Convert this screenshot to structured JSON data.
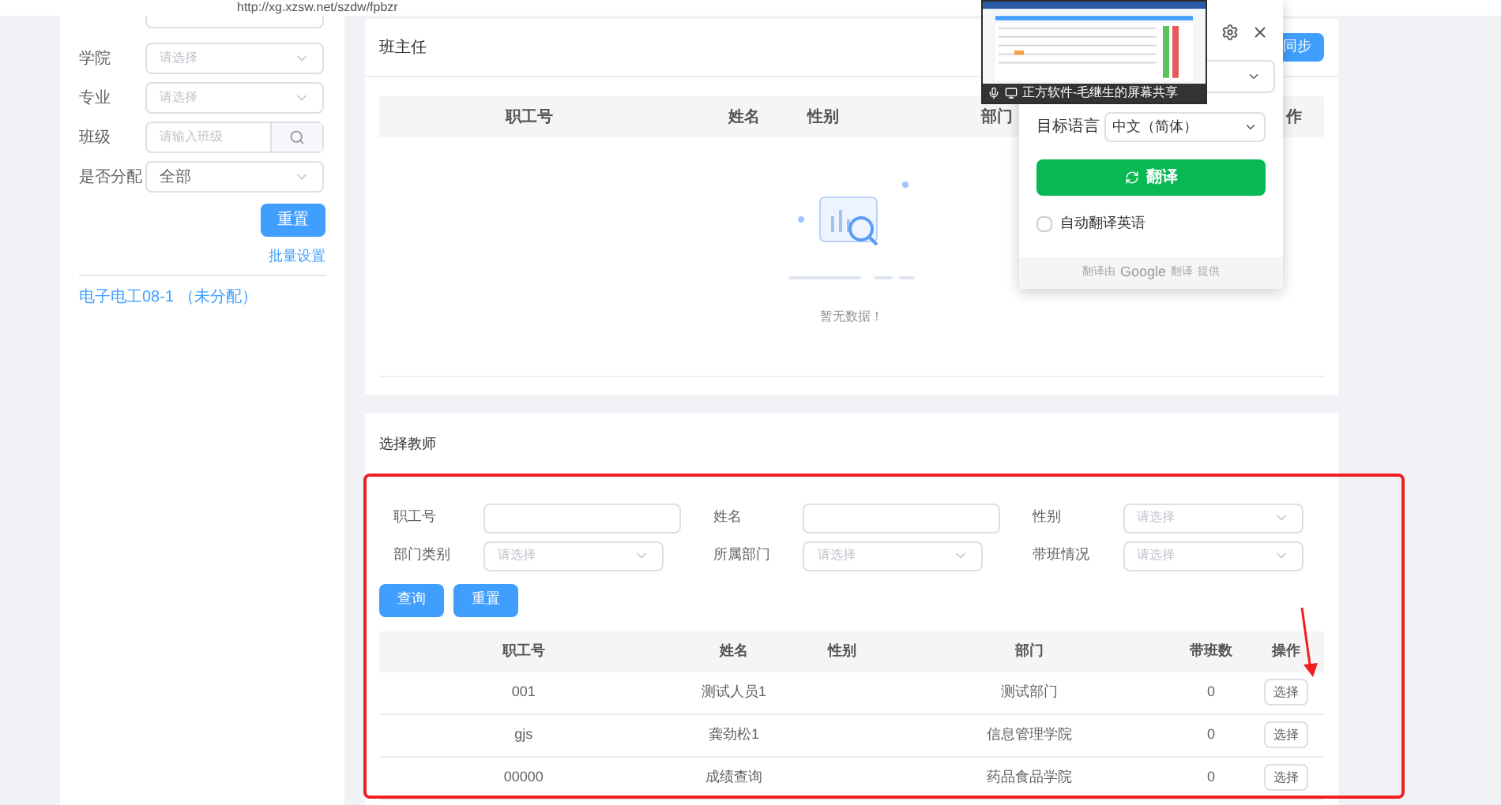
{
  "browser": {
    "url": "http://xg.xzsw.net/szdw/fpbzr"
  },
  "sidebar": {
    "filters": [
      {
        "label": "学院",
        "placeholder": "请选择",
        "kind": "select"
      },
      {
        "label": "专业",
        "placeholder": "请选择",
        "kind": "select"
      },
      {
        "label": "班级",
        "placeholder": "请输入班级",
        "kind": "search"
      },
      {
        "label": "是否分配",
        "value": "全部",
        "kind": "select"
      }
    ],
    "reset_button": "重置",
    "batch_link": "批量设置",
    "classes": [
      "电子电工08-1 （未分配）"
    ]
  },
  "head_teacher": {
    "title": "班主任",
    "sync_button": "同步",
    "columns": [
      "职工号",
      "姓名",
      "性别",
      "部门",
      "作"
    ],
    "empty_text": "暂无数据！"
  },
  "teacher_select": {
    "title": "选择教师",
    "filters": [
      {
        "label": "职工号",
        "kind": "input"
      },
      {
        "label": "姓名",
        "kind": "input"
      },
      {
        "label": "性别",
        "placeholder": "请选择",
        "kind": "select"
      },
      {
        "label": "部门类别",
        "placeholder": "请选择",
        "kind": "select"
      },
      {
        "label": "所属部门",
        "placeholder": "请选择",
        "kind": "select"
      },
      {
        "label": "带班情况",
        "placeholder": "请选择",
        "kind": "select"
      }
    ],
    "buttons": [
      "查询",
      "重置"
    ],
    "columns": [
      "职工号",
      "姓名",
      "性别",
      "部门",
      "带班数",
      "操作"
    ],
    "rows": [
      {
        "cells": [
          "001",
          "测试人员1",
          "",
          "测试部门",
          "0"
        ],
        "action": "选择"
      },
      {
        "cells": [
          "gjs",
          "龚劲松1",
          "",
          "信息管理学院",
          "0"
        ],
        "action": "选择"
      },
      {
        "cells": [
          "00000",
          "成绩查询",
          "",
          "药品食品学院",
          "0"
        ],
        "action": "选择"
      }
    ]
  },
  "translate_popup": {
    "target_label": "目标语言",
    "target_value": "中文（简体）",
    "translate_button": "翻译",
    "auto_checkbox": {
      "label": "自动翻译英语",
      "checked": false
    },
    "footer": {
      "before": "翻译由",
      "brand": "Google",
      "brand_after": "翻译",
      "after": "提供"
    }
  },
  "screen_share": {
    "caption": "正方软件-毛继生的屏幕共享"
  }
}
